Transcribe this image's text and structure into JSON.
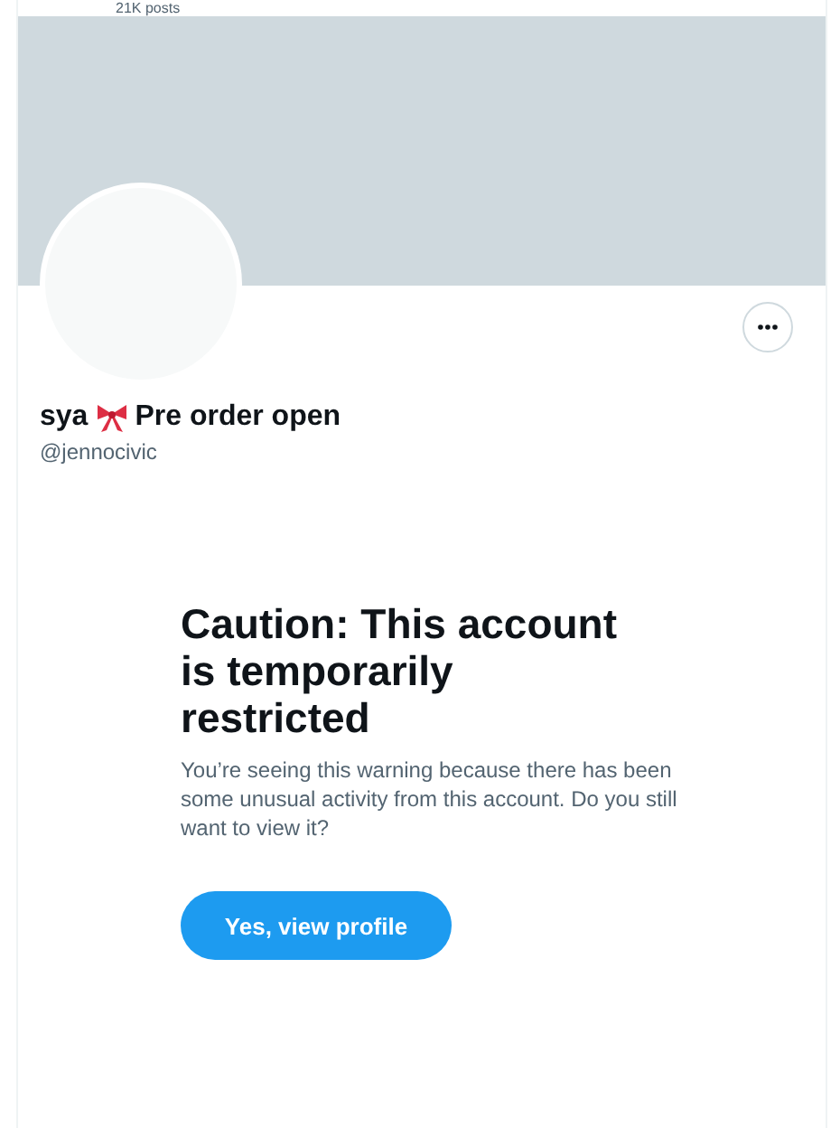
{
  "header": {
    "post_count": "21K posts"
  },
  "profile": {
    "name_before_icon": "sya",
    "name_after_icon": "Pre order open",
    "handle": "@jennocivic"
  },
  "warning": {
    "title": "Caution: This account is temporarily restricted",
    "message": "You’re seeing this warning because there has been some unusual activity from this account. Do you still want to view it?",
    "button": "Yes, view profile"
  }
}
